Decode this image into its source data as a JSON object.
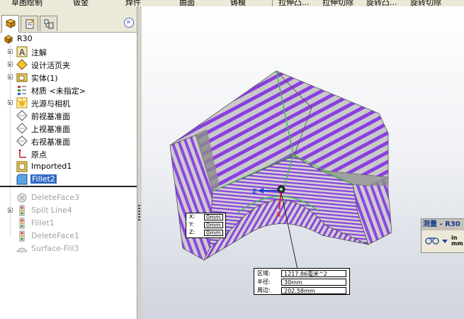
{
  "toolbar": {
    "items": [
      "草图绘制",
      "钣金",
      "焊件",
      "曲面",
      "铸模",
      "拉伸凸...",
      "拉伸切除",
      "旋转凸...",
      "旋转切除"
    ]
  },
  "panel_tabs": [
    {
      "icon": "feature-manager-icon",
      "active": true
    },
    {
      "icon": "property-manager-icon",
      "active": false
    },
    {
      "icon": "configuration-manager-icon",
      "active": false
    }
  ],
  "tree": {
    "root": "R30",
    "items": [
      {
        "label": "注解",
        "icon": "annotations-icon"
      },
      {
        "label": "设计活页夹",
        "icon": "design-binder-icon"
      },
      {
        "label": "实体(1)",
        "icon": "solid-bodies-icon"
      },
      {
        "label": "材质 <未指定>",
        "icon": "material-icon"
      },
      {
        "label": "光源与相机",
        "icon": "lights-cameras-icon"
      },
      {
        "label": "前视基准面",
        "icon": "plane-icon"
      },
      {
        "label": "上视基准面",
        "icon": "plane-icon"
      },
      {
        "label": "右视基准面",
        "icon": "plane-icon"
      },
      {
        "label": "原点",
        "icon": "origin-icon"
      },
      {
        "label": "Imported1",
        "icon": "imported-icon"
      },
      {
        "label": "Fillet2",
        "icon": "fillet-icon"
      },
      {
        "label": "DeleteFace3",
        "icon": "delete-face-icon"
      },
      {
        "label": "Split Line4",
        "icon": "split-line-icon"
      },
      {
        "label": "Fillet1",
        "icon": "fillet-icon"
      },
      {
        "label": "DeleteFace1",
        "icon": "delete-face-icon"
      },
      {
        "label": "Surface-Fill3",
        "icon": "surface-fill-icon"
      }
    ]
  },
  "coords": {
    "x_key": "X:",
    "x_val": "0mm",
    "y_key": "Y:",
    "y_val": "0mm",
    "z_key": "Z:",
    "z_val": "0mm"
  },
  "axis_labels": {
    "z": "Z",
    "x": "X"
  },
  "measure": {
    "area_key": "区域:",
    "area_val": "1217.86毫米^2",
    "radius_key": "半径:",
    "radius_val": "30mm",
    "perimeter_key": "周边:",
    "perimeter_val": "202.58mm"
  },
  "measure_panel": {
    "title": "测量 - R30",
    "unit_top": "in",
    "unit_bottom": "mm"
  },
  "colors": {
    "stripe_purple": "#8a3fe0",
    "stripe_grey": "#c7c7c7",
    "selection": "#316ac5"
  }
}
